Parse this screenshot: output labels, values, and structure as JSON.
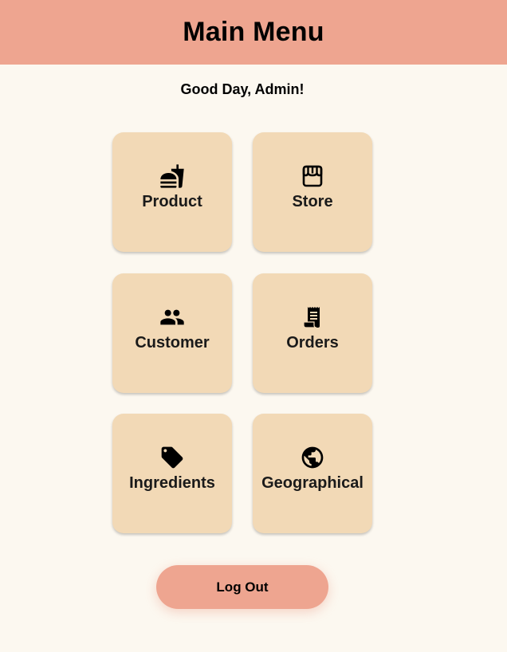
{
  "header": {
    "title": "Main Menu"
  },
  "greeting": "Good Day, Admin!",
  "menu": {
    "items": [
      {
        "label": "Product",
        "icon": "fastfood-icon"
      },
      {
        "label": "Store",
        "icon": "storefront-icon"
      },
      {
        "label": "Customer",
        "icon": "people-icon"
      },
      {
        "label": "Orders",
        "icon": "receipt-icon"
      },
      {
        "label": "Ingredients",
        "icon": "tag-icon"
      },
      {
        "label": "Geographical",
        "icon": "globe-icon"
      }
    ]
  },
  "logout": {
    "label": "Log Out"
  },
  "colors": {
    "header_bg": "#eea590",
    "page_bg": "#fcf8f0",
    "tile_bg": "#f2d9b6",
    "button_bg": "#eea590"
  }
}
